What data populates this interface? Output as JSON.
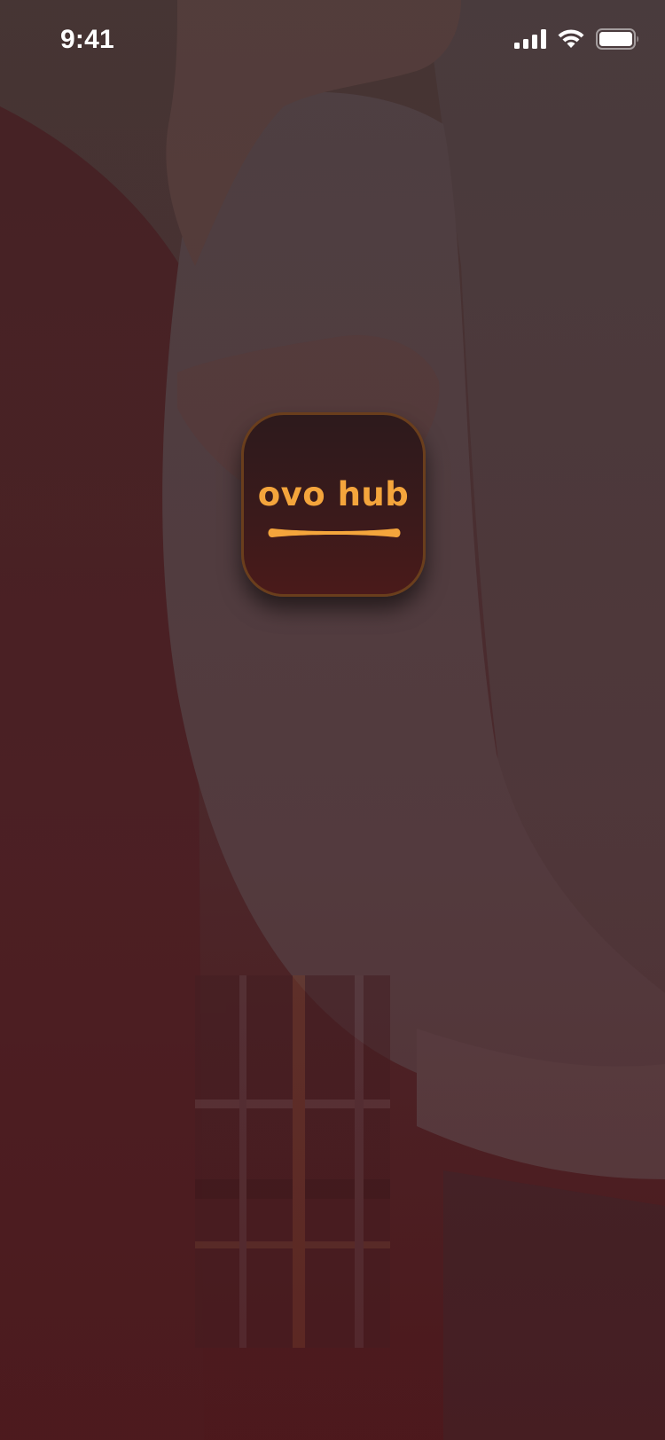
{
  "status_bar": {
    "time": "9:41",
    "icons": [
      "signal-icon",
      "wifi-icon",
      "battery-icon"
    ]
  },
  "app": {
    "name": "ovo hub",
    "accent_color": "#f4a53c",
    "icon_bg_color": "#3a1a1b"
  },
  "background": {
    "description_icon": "couple-embrace-photo"
  }
}
